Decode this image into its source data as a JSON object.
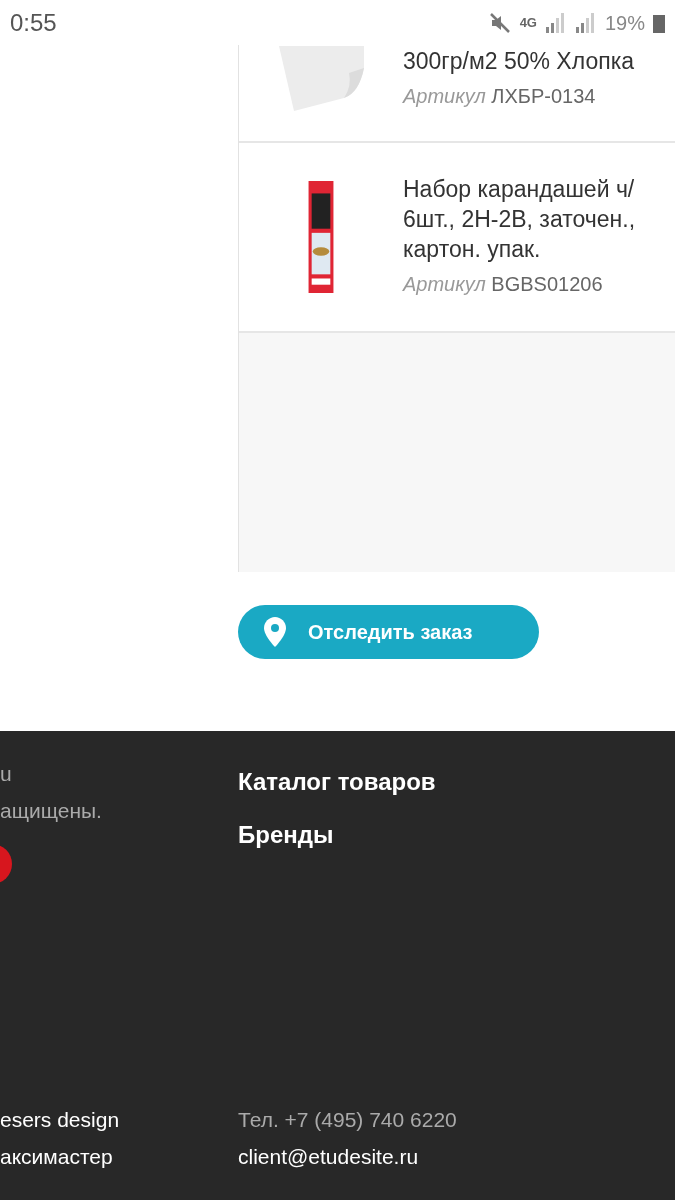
{
  "status_bar": {
    "time": "0:55",
    "network": "4G",
    "battery": "19%"
  },
  "order_items": [
    {
      "kind": "paper",
      "title_lines": [
        "300гр/м2 50% Хлопка"
      ],
      "article_label": "Артикул",
      "article": "ЛХБР-0134"
    },
    {
      "kind": "pencils",
      "title_lines": [
        "Набор карандашей ч/",
        "6шт., 2Н-2В, заточен.,",
        "картон. упак."
      ],
      "article_label": "Артикул",
      "article": "BGBS01206"
    }
  ],
  "track_button": {
    "label": "Отследить заказ"
  },
  "footer": {
    "left_top": [
      "u",
      "ащищены."
    ],
    "nav_links": [
      "Каталог товаров",
      "Бренды"
    ],
    "left_bottom": [
      "esers design",
      "аксимастер"
    ],
    "phone": "Тел. +7 (495) 740 6220",
    "email": "client@etudesite.ru"
  }
}
